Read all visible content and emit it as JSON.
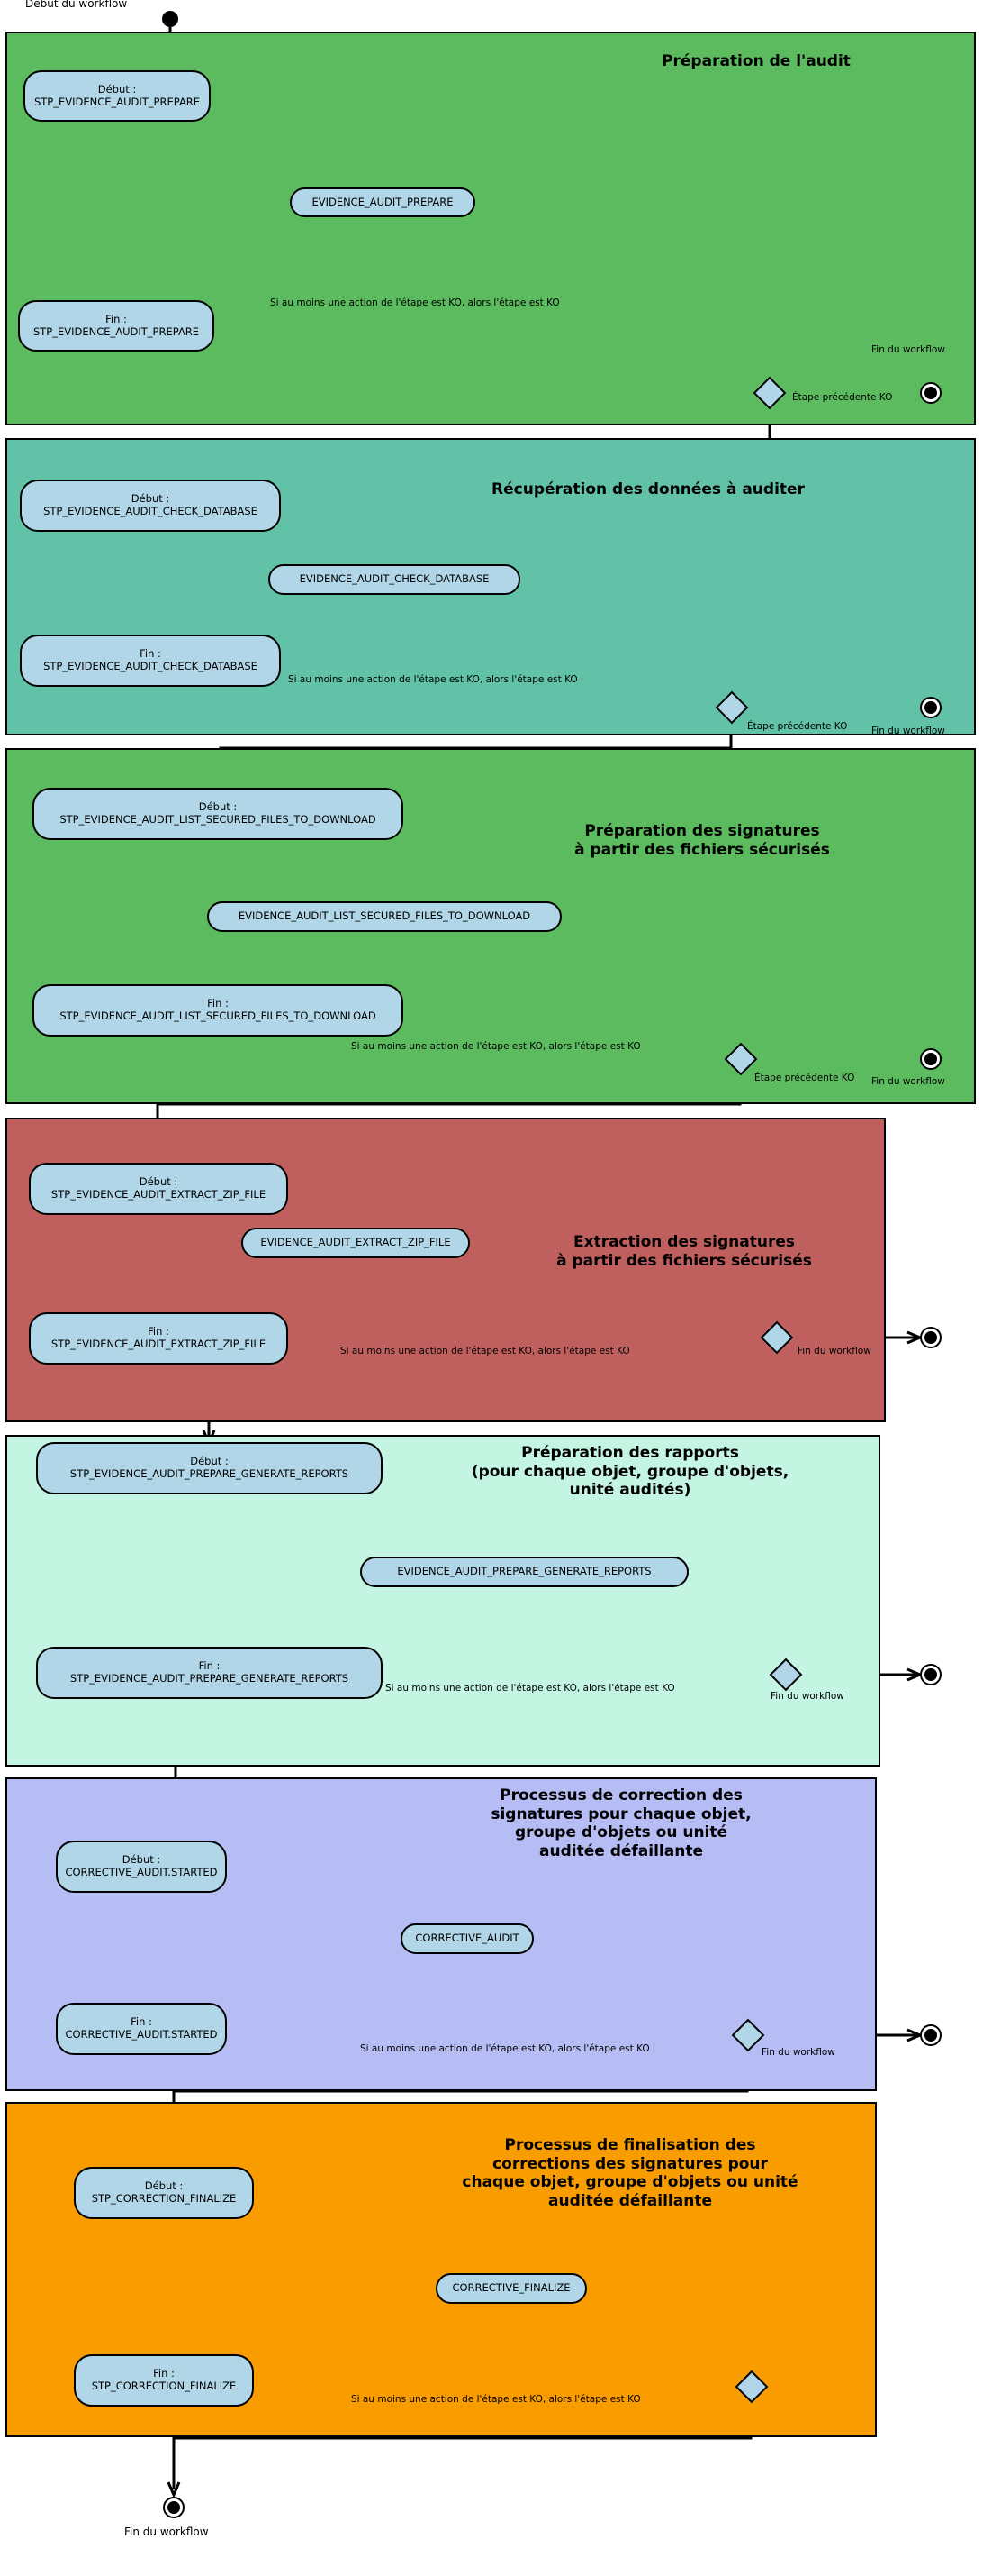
{
  "diagram": {
    "start_label": "Début du workflow",
    "end_label": "Fin du workflow",
    "condition_text": "Si au moins une action de l'étape est KO, alors l'étape est KO",
    "prev_step_ko_label": "Étape précédente KO",
    "colors": {
      "node_fill": "#b0d6e8",
      "section1": "#5cbb5f",
      "section2": "#61c2a8",
      "section3": "#5cbb5f",
      "section4": "#c0605e",
      "section5": "#c4f5e2",
      "section6": "#b6bdf5",
      "section7": "#f99c00"
    }
  },
  "sections": [
    {
      "id": "preparation-audit",
      "title": "Préparation de l'audit",
      "color": "#5cbb5f",
      "start_node": "Début :\nSTP_EVIDENCE_AUDIT_PREPARE",
      "start_node_line1": "Début :",
      "start_node_line2": "STP_EVIDENCE_AUDIT_PREPARE",
      "action_node": "EVIDENCE_AUDIT_PREPARE",
      "end_node_line1": "Fin :",
      "end_node_line2": "STP_EVIDENCE_AUDIT_PREPARE",
      "condition": "Si au moins une action de l'étape est KO, alors l'étape est KO",
      "decision_caption": "Étape précédente KO",
      "workflow_end_caption": "Fin du workflow"
    },
    {
      "id": "recuperation-donnees",
      "title": "Récupération des données à auditer",
      "color": "#61c2a8",
      "start_node_line1": "Début :",
      "start_node_line2": "STP_EVIDENCE_AUDIT_CHECK_DATABASE",
      "action_node": "EVIDENCE_AUDIT_CHECK_DATABASE",
      "end_node_line1": "Fin :",
      "end_node_line2": "STP_EVIDENCE_AUDIT_CHECK_DATABASE",
      "condition": "Si au moins une action de l'étape est KO, alors l'étape est KO",
      "decision_caption": "Étape précédente KO",
      "workflow_end_caption": "Fin du workflow"
    },
    {
      "id": "preparation-signatures",
      "title_line1": "Préparation des signatures",
      "title_line2": "à partir des fichiers sécurisés",
      "color": "#5cbb5f",
      "start_node_line1": "Début :",
      "start_node_line2": "STP_EVIDENCE_AUDIT_LIST_SECURED_FILES_TO_DOWNLOAD",
      "action_node": "EVIDENCE_AUDIT_LIST_SECURED_FILES_TO_DOWNLOAD",
      "end_node_line1": "Fin :",
      "end_node_line2": "STP_EVIDENCE_AUDIT_LIST_SECURED_FILES_TO_DOWNLOAD",
      "condition": "Si au moins une action de l'étape est KO, alors l'étape est KO",
      "decision_caption": "Étape précédente KO",
      "workflow_end_caption": "Fin du workflow"
    },
    {
      "id": "extraction-signatures",
      "title_line1": "Extraction des signatures",
      "title_line2": "à partir des fichiers sécurisés",
      "color": "#c0605e",
      "start_node_line1": "Début :",
      "start_node_line2": "STP_EVIDENCE_AUDIT_EXTRACT_ZIP_FILE",
      "action_node": "EVIDENCE_AUDIT_EXTRACT_ZIP_FILE",
      "end_node_line1": "Fin :",
      "end_node_line2": "STP_EVIDENCE_AUDIT_EXTRACT_ZIP_FILE",
      "condition": "Si au moins une action de l'étape est KO, alors l'étape est KO",
      "workflow_end_caption": "Fin du workflow"
    },
    {
      "id": "preparation-rapports",
      "title_line1": "Préparation des rapports",
      "title_line2": "(pour chaque objet, groupe d'objets,",
      "title_line3": "unité audités)",
      "color": "#c4f5e2",
      "start_node_line1": "Début :",
      "start_node_line2": "STP_EVIDENCE_AUDIT_PREPARE_GENERATE_REPORTS",
      "action_node": "EVIDENCE_AUDIT_PREPARE_GENERATE_REPORTS",
      "end_node_line1": "Fin :",
      "end_node_line2": "STP_EVIDENCE_AUDIT_PREPARE_GENERATE_REPORTS",
      "condition": "Si au moins une action de l'étape est KO, alors l'étape est KO",
      "workflow_end_caption": "Fin du workflow"
    },
    {
      "id": "processus-correction",
      "title_line1": "Processus de correction des",
      "title_line2": "signatures pour chaque objet,",
      "title_line3": "groupe d'objets ou unité",
      "title_line4": "auditée défaillante",
      "color": "#b6bdf5",
      "start_node_line1": "Début :",
      "start_node_line2": "CORRECTIVE_AUDIT.STARTED",
      "action_node": "CORRECTIVE_AUDIT",
      "end_node_line1": "Fin :",
      "end_node_line2": "CORRECTIVE_AUDIT.STARTED",
      "condition": "Si au moins une action de l'étape est KO, alors l'étape est KO",
      "workflow_end_caption": "Fin du workflow"
    },
    {
      "id": "processus-finalisation",
      "title_line1": "Processus de finalisation des",
      "title_line2": "corrections des signatures pour",
      "title_line3": "chaque objet, groupe d'objets ou unité",
      "title_line4": "auditée défaillante",
      "color": "#f99c00",
      "start_node_line1": "Début :",
      "start_node_line2": "STP_CORRECTION_FINALIZE",
      "action_node": "CORRECTIVE_FINALIZE",
      "end_node_line1": "Fin :",
      "end_node_line2": "STP_CORRECTION_FINALIZE",
      "condition": "Si au moins une action de l'étape est KO, alors l'étape est KO"
    }
  ],
  "final_end_caption": "Fin du workflow"
}
